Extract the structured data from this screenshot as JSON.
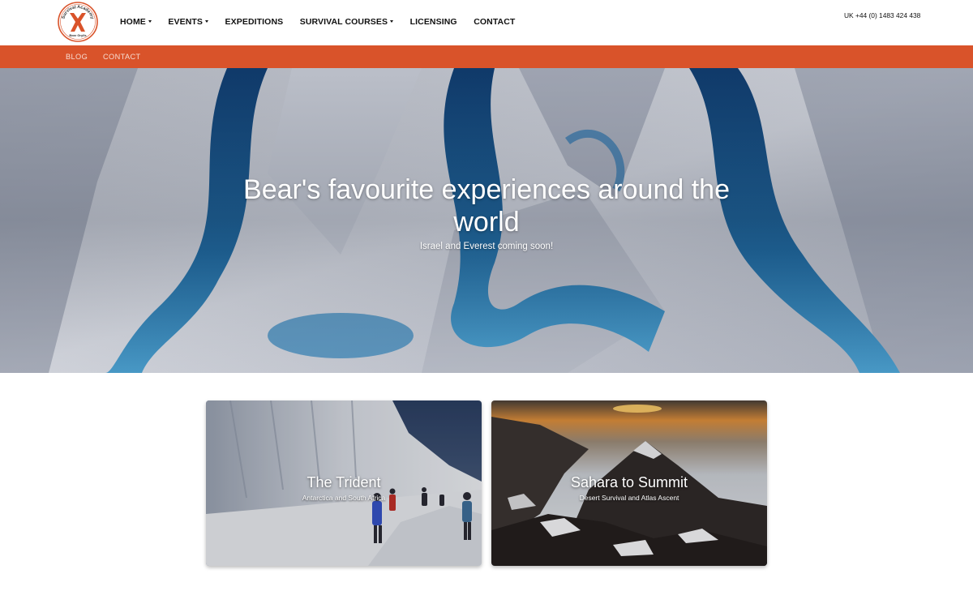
{
  "header": {
    "logo": {
      "name": "survival-academy-logo",
      "arc_text": "Survival Academy",
      "bottom_text": "Bear Grylls",
      "color": "#d9532a"
    },
    "nav": [
      {
        "label": "HOME",
        "has_dropdown": true
      },
      {
        "label": "EVENTS",
        "has_dropdown": true
      },
      {
        "label": "EXPEDITIONS",
        "has_dropdown": false
      },
      {
        "label": "SURVIVAL COURSES",
        "has_dropdown": true
      },
      {
        "label": "LICENSING",
        "has_dropdown": false
      },
      {
        "label": "CONTACT",
        "has_dropdown": false
      }
    ],
    "phone": "UK +44 (0) 1483 424 438"
  },
  "subnav": {
    "background": "#d9532a",
    "items": [
      "BLOG",
      "CONTACT"
    ]
  },
  "hero": {
    "title": "Bear's favourite experiences around the world",
    "subtitle": "Israel and Everest coming soon!"
  },
  "cards": [
    {
      "title": "The Trident",
      "subtitle": "Antarctica and South Africa"
    },
    {
      "title": "Sahara to Summit",
      "subtitle": "Desert Survival and Atlas Ascent"
    }
  ],
  "colors": {
    "accent": "#d9532a",
    "nav_text": "#111111",
    "glacier_blue": "#1f6fa8"
  }
}
